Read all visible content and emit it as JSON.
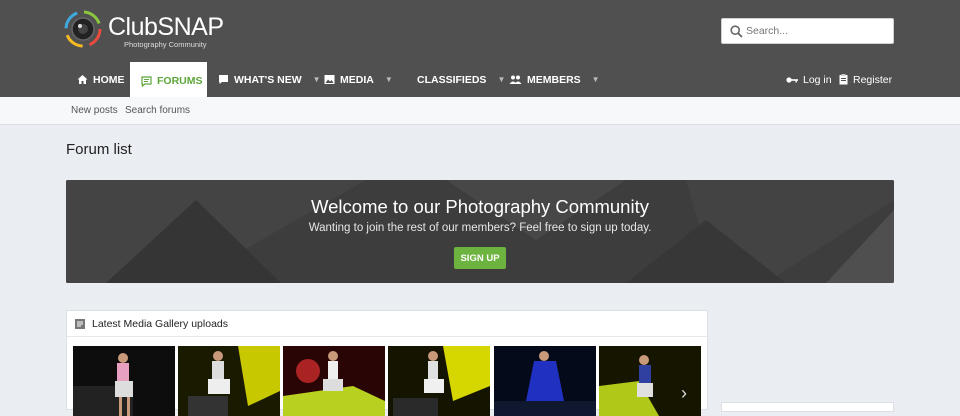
{
  "brand": {
    "name": "ClubSNAP",
    "tagline": "Photography Community"
  },
  "search": {
    "placeholder": "Search..."
  },
  "nav": {
    "items": [
      {
        "label": "HOME",
        "icon": "home-icon"
      },
      {
        "label": "FORUMS",
        "icon": "forums-icon",
        "active": true
      },
      {
        "label": "WHAT'S NEW",
        "icon": "whats-new-icon",
        "dropdown": true
      },
      {
        "label": "MEDIA",
        "icon": "media-icon",
        "dropdown": true
      },
      {
        "label": "CLASSIFIEDS",
        "dropdown": true
      },
      {
        "label": "MEMBERS",
        "icon": "members-icon",
        "dropdown": true
      }
    ],
    "login": "Log in",
    "register": "Register"
  },
  "subnav": {
    "new_posts": "New posts",
    "search_forums": "Search forums"
  },
  "page": {
    "title": "Forum list"
  },
  "banner": {
    "title": "Welcome to our Photography Community",
    "subtitle": "Wanting to join the rest of our members? Feel free to sign up today.",
    "button": "SIGN UP"
  },
  "media": {
    "heading": "Latest Media Gallery uploads",
    "thumbnails": [
      "thumb-1",
      "thumb-2",
      "thumb-3",
      "thumb-4",
      "thumb-5",
      "thumb-6"
    ]
  },
  "colors": {
    "header_bg": "#505050",
    "accent": "#6db33f",
    "page_bg": "#eaedf1"
  }
}
